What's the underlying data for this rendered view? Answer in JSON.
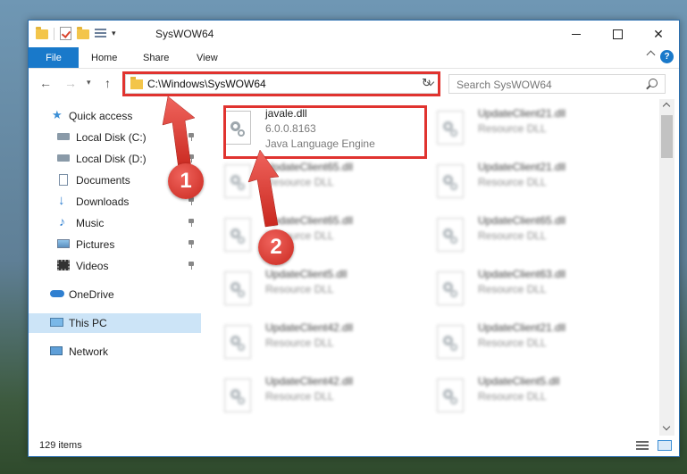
{
  "window": {
    "title": "SysWOW64",
    "minimize": "minimize",
    "maximize": "maximize",
    "close": "✕"
  },
  "ribbon": {
    "file_tab": "File",
    "tabs": [
      "Home",
      "Share",
      "View"
    ],
    "help": "?"
  },
  "address": {
    "path": "C:\\Windows\\SysWOW64",
    "search_placeholder": "Search SysWOW64"
  },
  "nav": {
    "quick_access": "Quick access",
    "items": [
      {
        "label": "Local Disk (C:)",
        "icon": "local-disk-icon",
        "pinned": true
      },
      {
        "label": "Local Disk (D:)",
        "icon": "local-disk-icon",
        "pinned": true
      },
      {
        "label": "Documents",
        "icon": "documents-icon",
        "pinned": true
      },
      {
        "label": "Downloads",
        "icon": "downloads-icon",
        "pinned": true
      },
      {
        "label": "Music",
        "icon": "music-icon",
        "pinned": true
      },
      {
        "label": "Pictures",
        "icon": "pictures-icon",
        "pinned": true
      },
      {
        "label": "Videos",
        "icon": "videos-icon",
        "pinned": true
      }
    ],
    "onedrive": "OneDrive",
    "this_pc": "This PC",
    "network": "Network"
  },
  "files": {
    "highlighted": {
      "name": "javale.dll",
      "version": "6.0.0.8163",
      "description": "Java Language Engine"
    },
    "left_column": [
      {
        "name": "UpdateClient65.dll",
        "description": "Resource DLL"
      },
      {
        "name": "UpdateClient65.dll",
        "description": "Resource DLL"
      },
      {
        "name": "UpdateClient5.dll",
        "description": "Resource DLL"
      },
      {
        "name": "UpdateClient42.dll",
        "description": "Resource DLL"
      },
      {
        "name": "UpdateClient42.dll",
        "description": "Resource DLL"
      }
    ],
    "right_column": [
      {
        "name": "UpdateClient21.dll",
        "description": "Resource DLL"
      },
      {
        "name": "UpdateClient21.dll",
        "description": "Resource DLL"
      },
      {
        "name": "UpdateClient65.dll",
        "description": "Resource DLL"
      },
      {
        "name": "UpdateClient63.dll",
        "description": "Resource DLL"
      },
      {
        "name": "UpdateClient21.dll",
        "description": "Resource DLL"
      },
      {
        "name": "UpdateClient5.dll",
        "description": "Resource DLL"
      }
    ]
  },
  "status": {
    "item_count": "129 items"
  },
  "callouts": {
    "one": "1",
    "two": "2"
  },
  "colors": {
    "accent": "#1979ca",
    "highlight_box": "#e0332f",
    "callout": "#d9362e",
    "selected_nav": "#cce4f7"
  }
}
